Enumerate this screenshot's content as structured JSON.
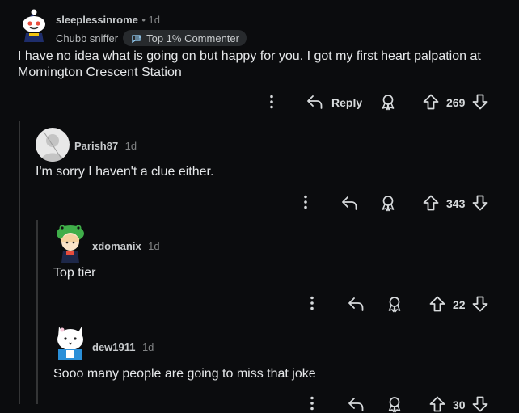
{
  "comments": [
    {
      "username": "sleeplessinrome",
      "time": "1d",
      "flair": "Chubb sniffer",
      "badge": "Top 1% Commenter",
      "body": "I have no idea what is going on but happy for you. I got my first heart palpation at Mornington Crescent Station",
      "reply_label": "Reply",
      "score": "269"
    },
    {
      "username": "Parish87",
      "time": "1d",
      "body": "I'm sorry I haven't a clue either.",
      "score": "343"
    },
    {
      "username": "xdomanix",
      "time": "1d",
      "body": "Top tier",
      "score": "22"
    },
    {
      "username": "dew1911",
      "time": "1d",
      "body": "Sooo many people are going to miss that joke",
      "score": "30"
    }
  ],
  "colors": {
    "background": "#0b0c0e",
    "text": "#d7dadc",
    "thread_line": "#343536"
  }
}
